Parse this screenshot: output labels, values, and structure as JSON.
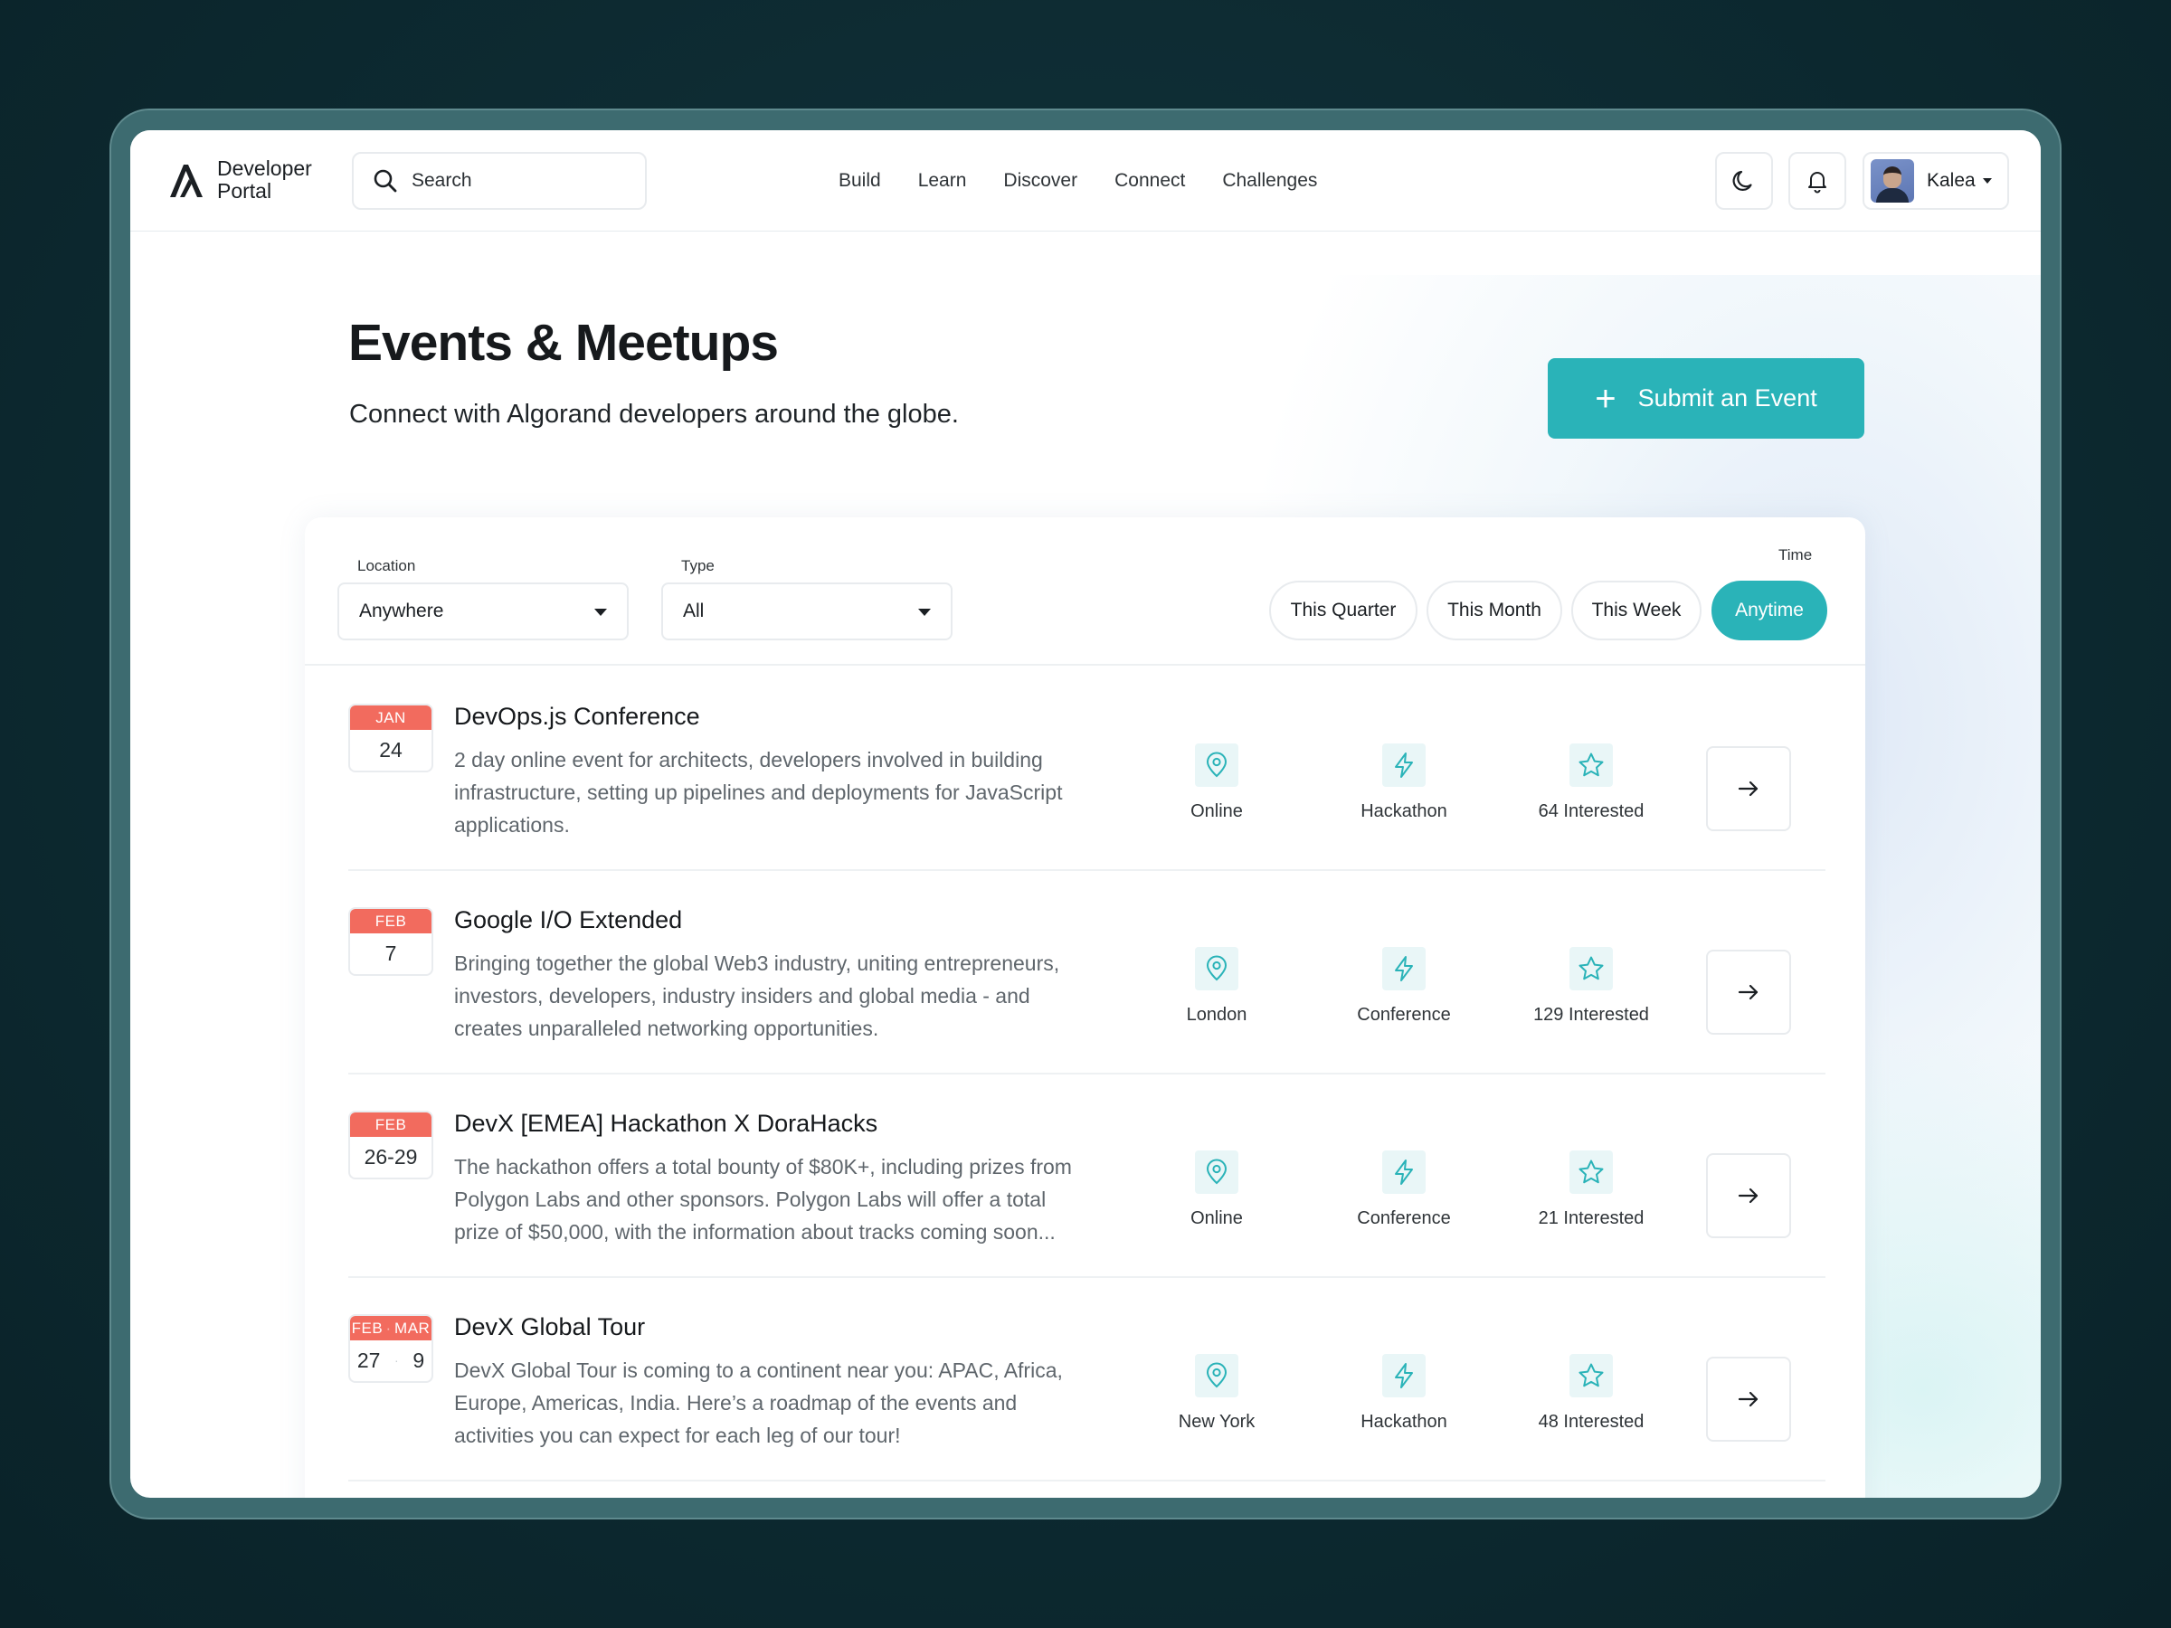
{
  "brand": {
    "line1": "Developer",
    "line2": "Portal"
  },
  "search": {
    "label": "Search"
  },
  "nav": [
    "Build",
    "Learn",
    "Discover",
    "Connect",
    "Challenges"
  ],
  "user": {
    "name": "Kalea"
  },
  "hero": {
    "title": "Events & Meetups",
    "subtitle": "Connect with Algorand developers around the globe.",
    "submit_label": "Submit an Event"
  },
  "filters": {
    "location": {
      "label": "Location",
      "value": "Anywhere"
    },
    "type": {
      "label": "Type",
      "value": "All"
    },
    "time": {
      "label": "Time",
      "options": [
        "This Quarter",
        "This Month",
        "This Week",
        "Anytime"
      ],
      "selected": "Anytime"
    }
  },
  "events": [
    {
      "month": "JAN",
      "day": "24",
      "title": "DevOps.js Conference",
      "description": "2 day online event for architects, developers involved in building infrastructure, setting up pipelines and deployments for JavaScript applications.",
      "location": "Online",
      "type": "Hackathon",
      "interested": "64 Interested"
    },
    {
      "month": "FEB",
      "day": "7",
      "title": "Google I/O Extended",
      "description": "Bringing together the global Web3 industry, uniting entrepreneurs, investors, developers, industry insiders and global media - and creates unparalleled networking opportunities.",
      "location": "London",
      "type": "Conference",
      "interested": "129 Interested"
    },
    {
      "month": "FEB",
      "day": "26-29",
      "title": "DevX [EMEA] Hackathon X DoraHacks",
      "description": "The hackathon offers a total bounty of $80K+, including prizes from Polygon Labs and other sponsors. Polygon Labs will offer a total prize of $50,000, with the information about tracks coming soon...",
      "location": "Online",
      "type": "Conference",
      "interested": "21 Interested"
    },
    {
      "month_start": "FEB",
      "month_end": "MAR",
      "day_start": "27",
      "day_end": "9",
      "title": "DevX Global Tour",
      "description": "DevX Global Tour is coming to a continent near you: APAC, Africa, Europe, Americas, India. Here’s a roadmap of the events and activities you can expect for each leg of our tour!",
      "location": "New York",
      "type": "Hackathon",
      "interested": "48 Interested"
    }
  ],
  "colors": {
    "accent": "#2ab3b8",
    "date_header": "#f26b5e",
    "icon_bg": "#e9f6f7"
  },
  "icons": {
    "search": "search-icon",
    "theme": "moon-icon",
    "notifications": "bell-icon",
    "location": "map-pin-icon",
    "type": "lightning-icon",
    "interested": "star-icon",
    "open": "arrow-right-icon"
  }
}
